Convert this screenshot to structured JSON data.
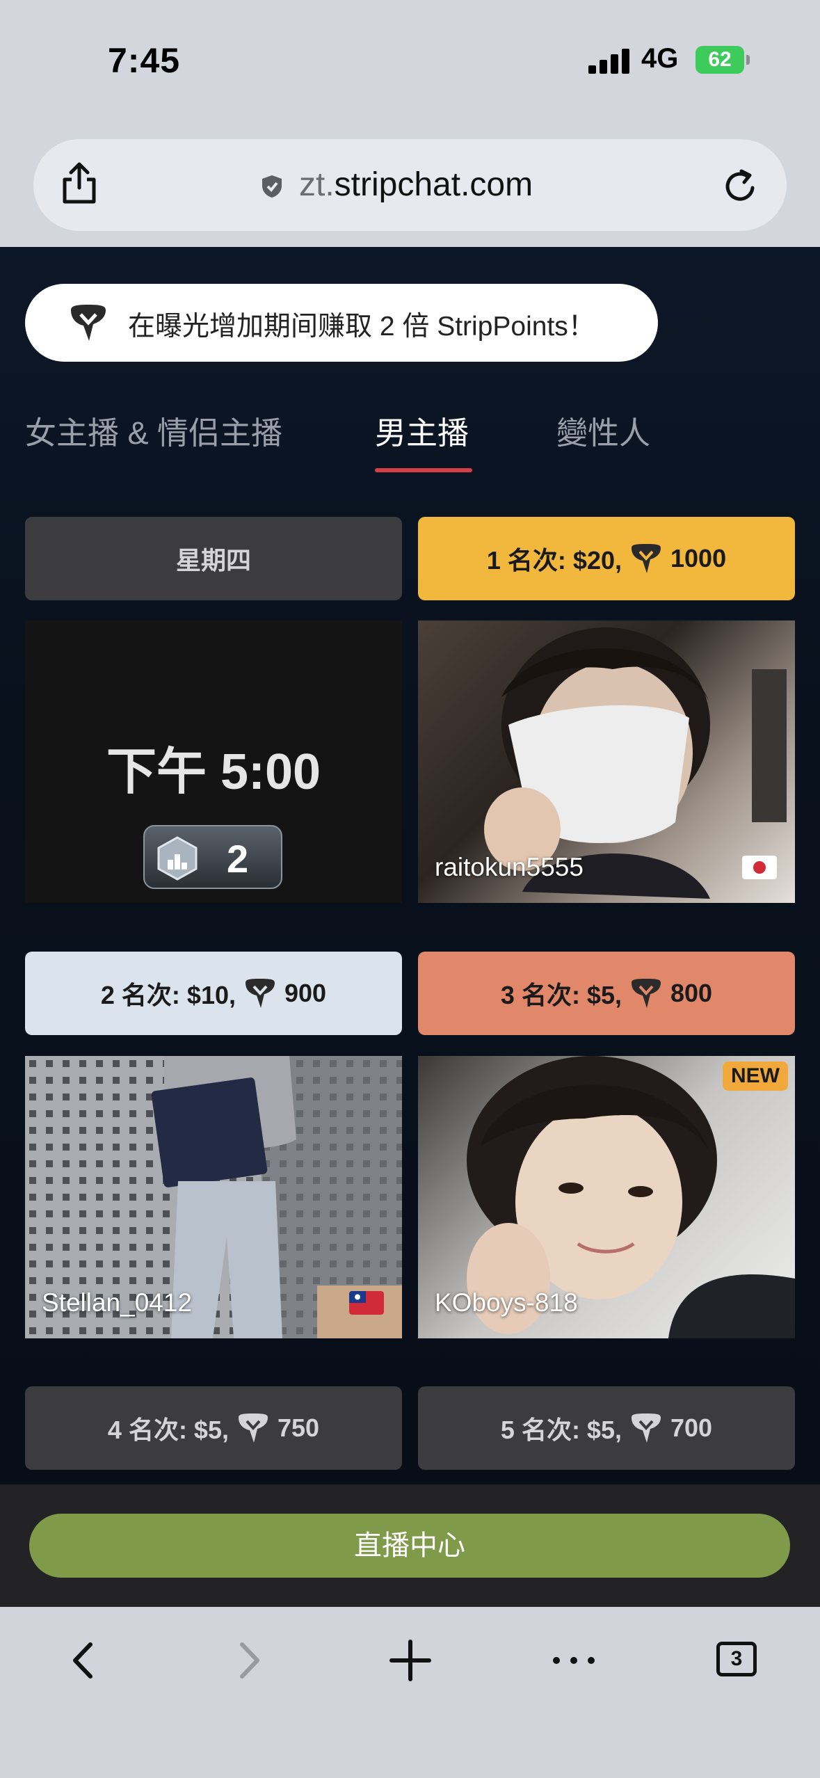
{
  "status": {
    "time": "7:45",
    "network": "4G",
    "battery": "62"
  },
  "browser": {
    "url_dim": "zt.",
    "url_main": "stripchat.com",
    "tabs_count": "3"
  },
  "banner": {
    "text": "在曝光增加期间赚取 2 倍 StripPoints！"
  },
  "tabs": [
    {
      "label": "女主播 & 情侣主播"
    },
    {
      "label": "男主播"
    },
    {
      "label": "變性人"
    }
  ],
  "schedule": {
    "day_label": "星期四",
    "time": "下午 5:00",
    "rank_badge": "2"
  },
  "prizes": [
    {
      "label": "1 名次: $20,",
      "points": "1000"
    },
    {
      "label": "2 名次: $10,",
      "points": "900"
    },
    {
      "label": "3 名次: $5,",
      "points": "800"
    },
    {
      "label": "4 名次: $5,",
      "points": "750"
    },
    {
      "label": "5 名次: $5,",
      "points": "700"
    }
  ],
  "models": [
    {
      "name": "raitokun5555",
      "flag": "japan-flag"
    },
    {
      "name": "Stellan_0412",
      "flag": "taiwan-flag"
    },
    {
      "name": "KOboys-818",
      "badge": "NEW"
    }
  ],
  "studio_button": "直播中心",
  "colors": {
    "accent": "#d33f48",
    "gold": "#f2b73d",
    "silver": "#dbe4ec",
    "bronze": "#e1886a",
    "studio": "#7f9a48"
  }
}
